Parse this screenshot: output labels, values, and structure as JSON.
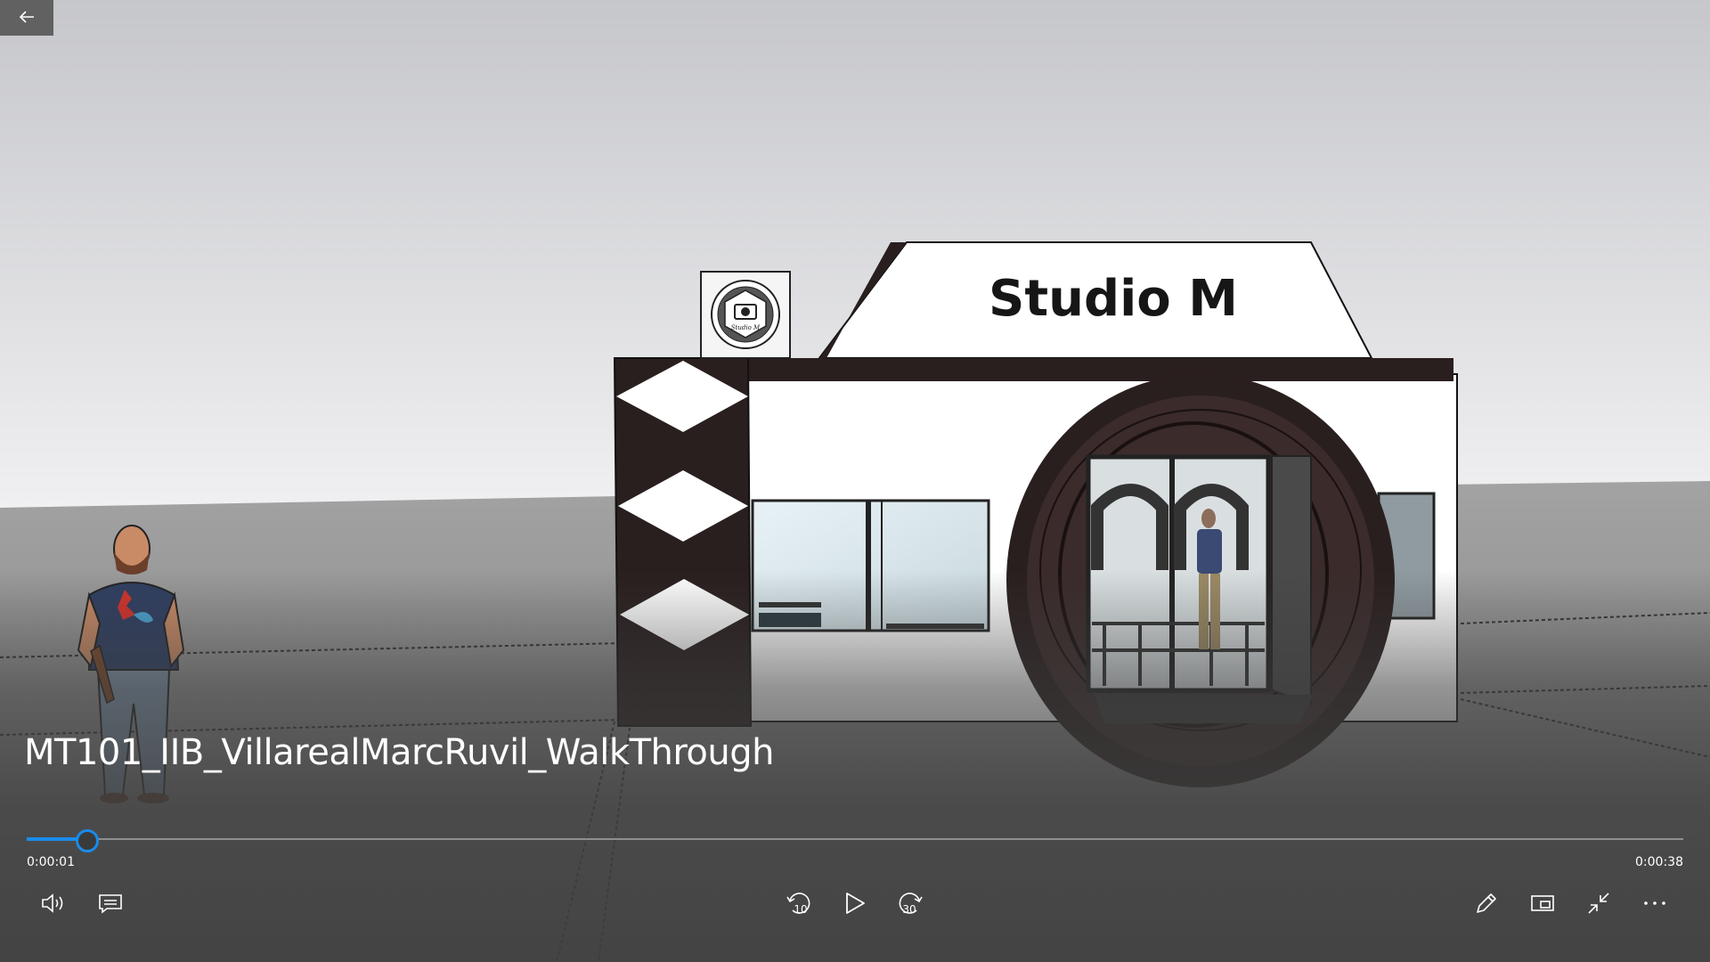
{
  "video": {
    "title": "MT101_IIB_VillarealMarcRuvil_WalkThrough",
    "current_time": "0:00:01",
    "duration": "0:00:38",
    "progress_fraction": 0.036
  },
  "scene": {
    "sign_text": "Studio M",
    "logo_text": "Studio M"
  },
  "controls": {
    "skip_back_seconds": "10",
    "skip_forward_seconds": "30"
  },
  "colors": {
    "accent": "#1a8ceb",
    "overlay": "#3e3e3e",
    "building_dark": "#2a1f1f"
  },
  "icons": [
    "back-arrow-icon",
    "volume-icon",
    "captions-icon",
    "skip-back-10-icon",
    "play-icon",
    "skip-forward-30-icon",
    "pen-icon",
    "mini-view-icon",
    "exit-fullscreen-icon",
    "more-icon"
  ]
}
